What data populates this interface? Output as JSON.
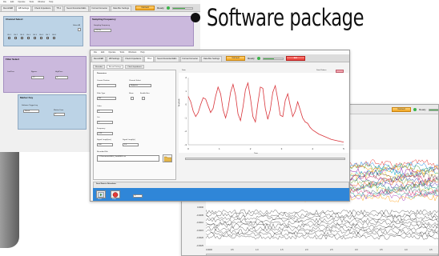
{
  "headline": {
    "text": "Software package"
  },
  "back_window": {
    "menu": [
      "File",
      "Edit",
      "Operate",
      "Tools",
      "Window",
      "Help"
    ],
    "tabs": [
      "Record/EB",
      "EB Settings",
      "Check Impedance",
      "TTL1",
      "Neuro Recorded EEG",
      "Format Converter",
      "Data Box Settings"
    ],
    "connect_label": "Connect",
    "ready_label": "Ready",
    "disconnect_label": "Exit",
    "progress": 0.65,
    "channel_select": {
      "title": "Channel Select",
      "select_all": "Select All",
      "channels": [
        "CH 1",
        "CH 2",
        "CH 3",
        "CH 4",
        "CH 5",
        "CH 6",
        "CH 7",
        "CH 8"
      ]
    },
    "sampling": {
      "title": "Sampling Frequency",
      "field_label": "Sampling Frequency",
      "value": "250 Hz"
    },
    "filter_select": {
      "title": "Filter Select",
      "lowpass_label": "LowPass",
      "bypass_label": "Bypass",
      "highpass_label": "HighPass",
      "value1": "15",
      "value2": "0"
    },
    "marker_key": {
      "title": "Marker Key",
      "software_trigger_label": "Software Trigger key",
      "value": "Shock",
      "marker_data_label": "Marker Data",
      "marker_value": "1"
    }
  },
  "middle_window": {
    "menu": [
      "File",
      "Edit",
      "Operate",
      "Tools",
      "Windows",
      "Help"
    ],
    "tabs": [
      "Record/EB",
      "EB Settings",
      "Check Impedance",
      "TTL1",
      "Neuro Recorded EEG",
      "Format Converter",
      "Data Box Settings"
    ],
    "connect_label": "Connect",
    "ready_label": "Ready",
    "exit_label": "Exit",
    "progress": 0.55,
    "subtabs": [
      "Recorder",
      "Record Settings",
      "Check Impedance"
    ],
    "params": {
      "title": "Parameters",
      "current_device_label": "Current Position",
      "current_device_value": "0",
      "channel_select_label": "Channel Select",
      "channel_select_value": "Highpass",
      "filter_type_label": "Filter Type",
      "filter_type_value": "Bar",
      "show_label": "Show",
      "enable_label": "Enable filter",
      "order_label": "Order",
      "order_value": "4",
      "cutoff_label": "Cut",
      "cutoff_value": "0",
      "frequency_label": "Frequency",
      "frequency_value": "0.25",
      "signal_len_label": "Signal Length(ms)",
      "signal_len_value": "300",
      "signal_len2_label": "Signal Length(s)",
      "signal_len2_value": "0.4",
      "filename_label": "Recorded File",
      "filename_value": "C:\\Documents\\EEG_Data\\EEG.csv"
    },
    "chart": {
      "title": "Data",
      "legend_label": "Data Pattern",
      "xlabel": "Time",
      "ylabel": "Amplitude"
    },
    "send_panel": {
      "title": "Send Data to Stimulator",
      "start_label": "Start",
      "stop_label": "Stop",
      "value": "0"
    }
  },
  "front_window": {
    "connect_label": "Connect",
    "ready_label": "Ready",
    "progress": 0.7,
    "y_ticks": [
      "0.0010",
      "0.0005",
      "0.0000",
      "-0.0005",
      "-0.0010",
      "-0.0015",
      "-0.0020",
      "-0.0025"
    ],
    "x_ticks": [
      "0.0000",
      "0.5",
      "1.0",
      "1.5",
      "2.0",
      "2.5",
      "3.0",
      "3.5",
      "4.0",
      "4.5"
    ]
  },
  "colors": {
    "blue_panel": "#bcd3e6",
    "purple_panel": "#cbb9dd",
    "red_line": "#d9343a",
    "accent_blue": "#2f86d8",
    "ready_green": "#3cb34a",
    "connect_orange": "#f0a41c"
  },
  "chart_data": [
    {
      "type": "line",
      "title": "",
      "series": [
        {
          "name": "",
          "x": [
            0,
            0.08,
            0.16,
            0.24,
            0.32,
            0.4,
            0.48,
            0.56,
            0.64,
            0.72,
            0.8,
            0.88,
            0.96,
            1.04,
            1.12,
            1.2,
            1.28,
            1.36,
            1.44,
            1.52,
            1.6,
            1.68,
            1.76,
            1.84,
            1.92,
            2.0,
            2.08,
            2.16,
            2.24,
            2.32,
            2.4,
            2.48,
            2.56,
            2.64,
            2.72,
            2.8,
            2.88,
            2.96,
            3.04,
            3.12,
            3.2,
            3.28,
            3.36,
            3.44,
            3.52,
            3.6,
            3.68,
            3.76,
            3.84,
            3.92,
            4.0,
            4.2,
            4.4,
            4.6,
            4.8,
            5.0
          ],
          "values": [
            0.6,
            0.2,
            -0.5,
            -0.9,
            -0.6,
            0.0,
            0.5,
            0.4,
            -0.1,
            -0.6,
            -0.3,
            0.6,
            1.3,
            0.8,
            -0.4,
            -1.0,
            -0.3,
            0.9,
            1.5,
            0.7,
            -0.7,
            -1.2,
            -0.2,
            1.1,
            1.6,
            0.5,
            -0.9,
            -1.3,
            0.1,
            1.3,
            1.2,
            -0.3,
            -1.1,
            -0.4,
            0.9,
            1.4,
            0.4,
            -0.8,
            -0.9,
            0.3,
            0.8,
            -0.1,
            -0.9,
            -0.5,
            0.2,
            -0.4,
            -1.0,
            -1.3,
            -1.4,
            -1.7,
            -1.9,
            -2.2,
            -2.4,
            -2.6,
            -2.7,
            -2.8
          ]
        }
      ],
      "xlim": [
        0,
        5
      ],
      "ylim": [
        -3,
        2
      ],
      "xlabel": "Time",
      "ylabel": "Amplitude"
    }
  ]
}
